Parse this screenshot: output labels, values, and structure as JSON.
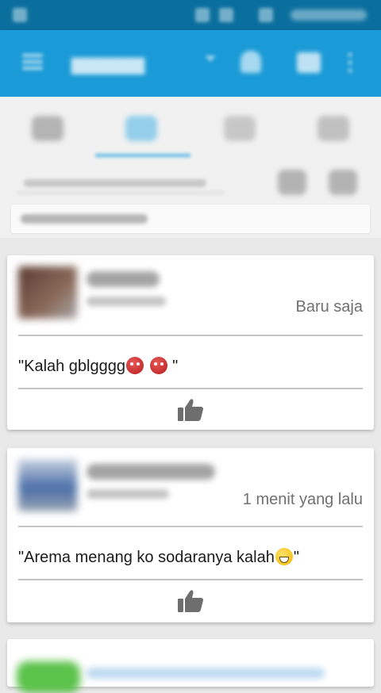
{
  "posts": [
    {
      "time": "Baru saja",
      "comment_open": "\"Kalah gblgggg",
      "comment_close": " \""
    },
    {
      "time": "1 menit yang lalu",
      "comment_open": "\"Arema menang ko sodaranya kalah",
      "comment_close": "\""
    }
  ],
  "icons": {
    "like": "thumbs-up-icon",
    "emoji_angry": "angry-face-emoji",
    "emoji_grin": "grinning-face-emoji"
  }
}
